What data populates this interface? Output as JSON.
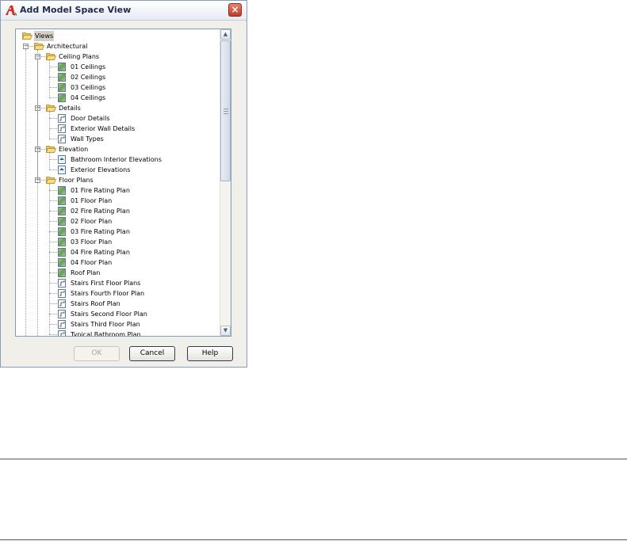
{
  "dialog": {
    "title": "Add Model Space View",
    "close_label": "×",
    "buttons": {
      "ok": "OK",
      "cancel": "Cancel",
      "help": "Help"
    }
  },
  "tree": [
    {
      "label": "Views",
      "level": 0,
      "icon": "folder-open-icon",
      "expander": "",
      "selected": true
    },
    {
      "label": "Architectural",
      "level": 1,
      "icon": "folder-open-icon",
      "expander": "−"
    },
    {
      "label": "Ceiling Plans",
      "level": 2,
      "icon": "folder-open-icon",
      "expander": "−"
    },
    {
      "label": "01 Ceilings",
      "level": 3,
      "icon": "plan-view-icon"
    },
    {
      "label": "02 Ceilings",
      "level": 3,
      "icon": "plan-view-icon"
    },
    {
      "label": "03 Ceilings",
      "level": 3,
      "icon": "plan-view-icon"
    },
    {
      "label": "04 Ceilings",
      "level": 3,
      "icon": "plan-view-icon"
    },
    {
      "label": "Details",
      "level": 2,
      "icon": "folder-open-icon",
      "expander": "−"
    },
    {
      "label": "Door Details",
      "level": 3,
      "icon": "detail-view-icon"
    },
    {
      "label": "Exterior Wall Details",
      "level": 3,
      "icon": "detail-view-icon"
    },
    {
      "label": "Wall Types",
      "level": 3,
      "icon": "detail-view-icon"
    },
    {
      "label": "Elevation",
      "level": 2,
      "icon": "folder-open-icon",
      "expander": "−"
    },
    {
      "label": "Bathroom Interior Elevations",
      "level": 3,
      "icon": "elevation-view-icon"
    },
    {
      "label": "Exterior Elevations",
      "level": 3,
      "icon": "elevation-view-icon"
    },
    {
      "label": "Floor Plans",
      "level": 2,
      "icon": "folder-open-icon",
      "expander": "−"
    },
    {
      "label": "01 Fire Rating Plan",
      "level": 3,
      "icon": "plan-view-icon"
    },
    {
      "label": "01 Floor Plan",
      "level": 3,
      "icon": "plan-view-icon"
    },
    {
      "label": "02 Fire Rating Plan",
      "level": 3,
      "icon": "plan-view-icon"
    },
    {
      "label": "02 Floor Plan",
      "level": 3,
      "icon": "plan-view-icon"
    },
    {
      "label": "03 Fire Rating Plan",
      "level": 3,
      "icon": "plan-view-icon"
    },
    {
      "label": "03 Floor Plan",
      "level": 3,
      "icon": "plan-view-icon"
    },
    {
      "label": "04 Fire Rating Plan",
      "level": 3,
      "icon": "plan-view-icon"
    },
    {
      "label": "04 Floor Plan",
      "level": 3,
      "icon": "plan-view-icon"
    },
    {
      "label": "Roof Plan",
      "level": 3,
      "icon": "plan-view-icon"
    },
    {
      "label": "Stairs First Floor Plans",
      "level": 3,
      "icon": "detail-view-icon"
    },
    {
      "label": "Stairs Fourth Floor Plan",
      "level": 3,
      "icon": "detail-view-icon"
    },
    {
      "label": "Stairs Roof Plan",
      "level": 3,
      "icon": "detail-view-icon"
    },
    {
      "label": "Stairs Second Floor Plan",
      "level": 3,
      "icon": "detail-view-icon"
    },
    {
      "label": "Stairs Third Floor Plan",
      "level": 3,
      "icon": "detail-view-icon"
    },
    {
      "label": "Typical Bathroom Plan",
      "level": 3,
      "icon": "detail-view-icon"
    }
  ],
  "scrollbar": {
    "up": "▲",
    "down": "▼"
  },
  "colors": {
    "selection": "#d4d0c8",
    "folder": "#f2d57a",
    "close": "#c0392b"
  }
}
